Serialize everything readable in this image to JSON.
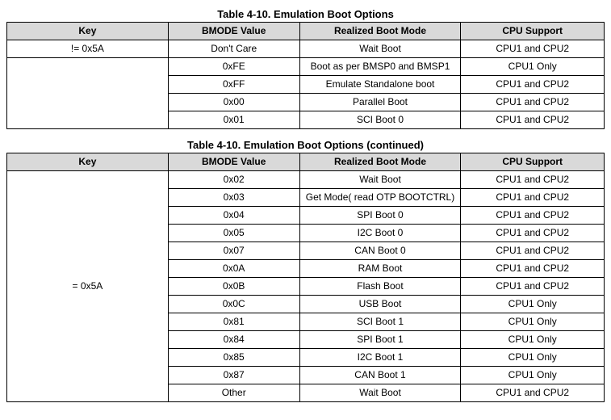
{
  "table1": {
    "caption": "Table 4-10. Emulation Boot Options",
    "headers": {
      "key": "Key",
      "bmode": "BMODE Value",
      "mode": "Realized Boot Mode",
      "cpu": "CPU Support"
    },
    "rows": [
      {
        "key": "!= 0x5A",
        "bmode": "Don't Care",
        "mode": "Wait Boot",
        "cpu": "CPU1 and CPU2"
      },
      {
        "key": "",
        "bmode": "0xFE",
        "mode": "Boot as per BMSP0 and BMSP1",
        "cpu": "CPU1 Only"
      },
      {
        "key": "",
        "bmode": "0xFF",
        "mode": "Emulate Standalone boot",
        "cpu": "CPU1 and CPU2"
      },
      {
        "key": "",
        "bmode": "0x00",
        "mode": "Parallel Boot",
        "cpu": "CPU1 and CPU2"
      },
      {
        "key": "",
        "bmode": "0x01",
        "mode": "SCI Boot 0",
        "cpu": "CPU1 and CPU2"
      }
    ]
  },
  "table2": {
    "caption": "Table 4-10. Emulation Boot Options (continued)",
    "headers": {
      "key": "Key",
      "bmode": "BMODE Value",
      "mode": "Realized Boot Mode",
      "cpu": "CPU Support"
    },
    "keyLabel": "= 0x5A",
    "rows": [
      {
        "bmode": "0x02",
        "mode": "Wait Boot",
        "cpu": "CPU1 and CPU2"
      },
      {
        "bmode": "0x03",
        "mode": "Get Mode( read OTP BOOTCTRL)",
        "cpu": "CPU1 and CPU2"
      },
      {
        "bmode": "0x04",
        "mode": "SPI Boot 0",
        "cpu": "CPU1 and CPU2"
      },
      {
        "bmode": "0x05",
        "mode": "I2C Boot 0",
        "cpu": "CPU1 and CPU2"
      },
      {
        "bmode": "0x07",
        "mode": "CAN Boot 0",
        "cpu": "CPU1 and CPU2"
      },
      {
        "bmode": "0x0A",
        "mode": "RAM Boot",
        "cpu": "CPU1 and CPU2"
      },
      {
        "bmode": "0x0B",
        "mode": "Flash Boot",
        "cpu": "CPU1 and CPU2"
      },
      {
        "bmode": "0x0C",
        "mode": "USB Boot",
        "cpu": "CPU1 Only"
      },
      {
        "bmode": "0x81",
        "mode": "SCI Boot 1",
        "cpu": "CPU1 Only"
      },
      {
        "bmode": "0x84",
        "mode": "SPI Boot 1",
        "cpu": "CPU1 Only"
      },
      {
        "bmode": "0x85",
        "mode": "I2C Boot 1",
        "cpu": "CPU1 Only"
      },
      {
        "bmode": "0x87",
        "mode": "CAN Boot 1",
        "cpu": "CPU1 Only"
      },
      {
        "bmode": "Other",
        "mode": "Wait Boot",
        "cpu": "CPU1 and CPU2"
      }
    ]
  }
}
